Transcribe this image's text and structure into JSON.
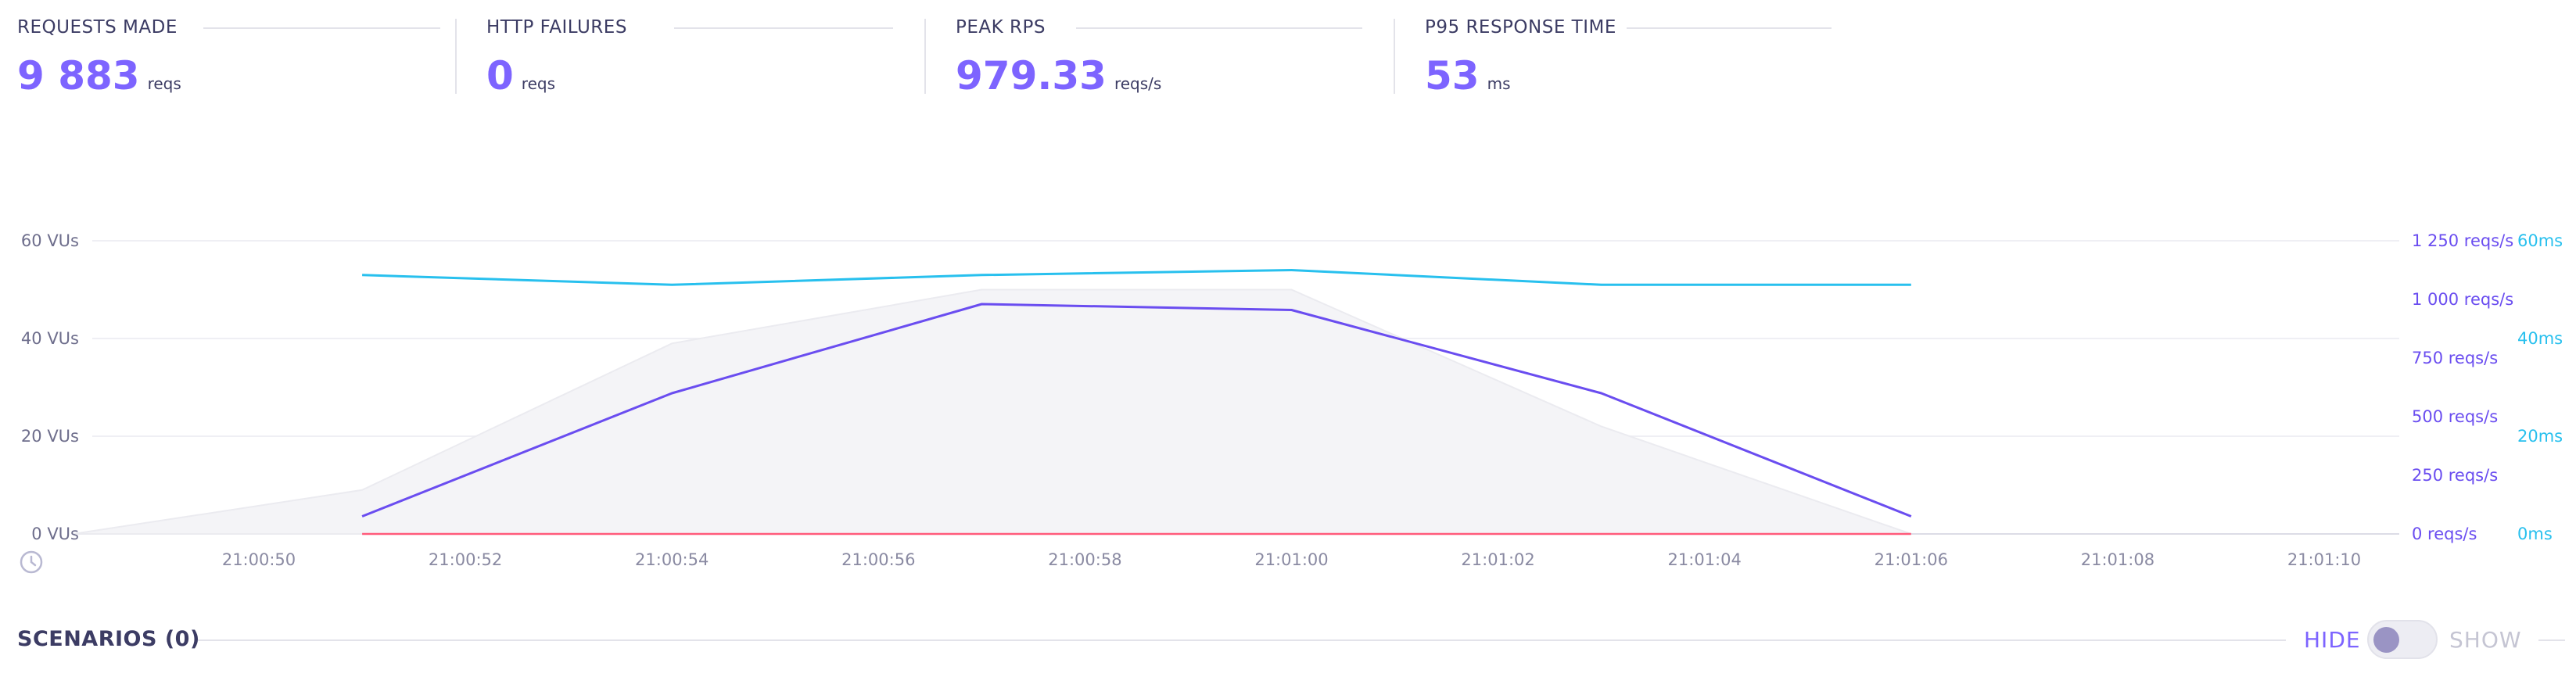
{
  "metrics": [
    {
      "title": "REQUESTS MADE",
      "value": "9 883",
      "unit": "reqs"
    },
    {
      "title": "HTTP FAILURES",
      "value": "0",
      "unit": "reqs"
    },
    {
      "title": "PEAK RPS",
      "value": "979.33",
      "unit": "reqs/s"
    },
    {
      "title": "P95 RESPONSE TIME",
      "value": "53",
      "unit": "ms"
    }
  ],
  "colors": {
    "accent": "#7d64ff",
    "rps_line": "#6a4df0",
    "response_time_line": "#28c0ee",
    "vus_area": "#f4f4f7",
    "failures_line": "#ff5a7a"
  },
  "icons": {
    "time_axis": "clock-icon"
  },
  "chart_data": {
    "type": "line",
    "x_ticks": [
      "21:00:50",
      "21:00:52",
      "21:00:54",
      "21:00:56",
      "21:00:58",
      "21:01:00",
      "21:01:02",
      "21:01:04",
      "21:01:06",
      "21:01:08",
      "21:01:10"
    ],
    "y_left_ticks": [
      "0 VUs",
      "20 VUs",
      "40 VUs",
      "60 VUs"
    ],
    "y_left_range": [
      0,
      60
    ],
    "y_rps_ticks": [
      "0 reqs/s",
      "250 reqs/s",
      "500 reqs/s",
      "750 reqs/s",
      "1 000 reqs/s",
      "1 250 reqs/s"
    ],
    "y_rps_range": [
      0,
      1250
    ],
    "y_ms_ticks": [
      "0ms",
      "20ms",
      "40ms",
      "60ms"
    ],
    "y_ms_range": [
      0,
      60
    ],
    "grid": true,
    "series": [
      {
        "key": "vus",
        "axis": "left",
        "style": "area",
        "x": [
          "21:00:48.2",
          "21:00:51",
          "21:00:54",
          "21:00:57",
          "21:01:00",
          "21:01:03",
          "21:01:06"
        ],
        "values": [
          0,
          9,
          39,
          50,
          50,
          22,
          0
        ]
      },
      {
        "key": "rps",
        "axis": "rps",
        "style": "line",
        "x": [
          "21:00:51",
          "21:00:54",
          "21:00:57",
          "21:01:00",
          "21:01:03",
          "21:01:06"
        ],
        "values": [
          75,
          600,
          980,
          955,
          600,
          75
        ]
      },
      {
        "key": "response_time",
        "axis": "ms",
        "style": "line",
        "x": [
          "21:00:51",
          "21:00:54",
          "21:00:57",
          "21:01:00",
          "21:01:03",
          "21:01:06"
        ],
        "values": [
          53,
          51,
          53,
          54,
          51,
          51
        ]
      },
      {
        "key": "failures",
        "axis": "rps",
        "style": "line",
        "x": [
          "21:00:51",
          "21:01:06"
        ],
        "values": [
          0,
          0
        ]
      }
    ]
  },
  "scenarios": {
    "title": "SCENARIOS (0)",
    "hide_label": "HIDE",
    "show_label": "SHOW"
  }
}
